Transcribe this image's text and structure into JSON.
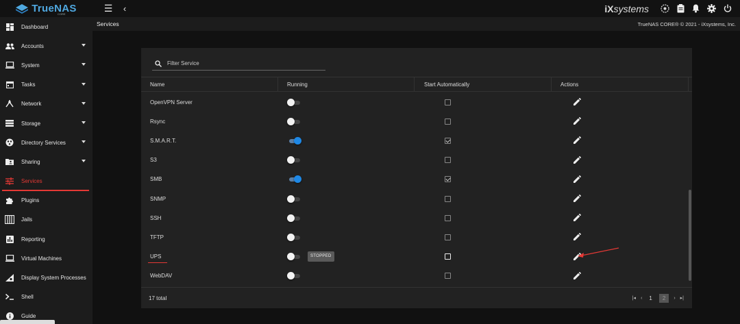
{
  "topbar": {
    "brand": "TrueNAS",
    "brand_sub": "CORE",
    "vendor_logo": "iXsystems",
    "icons": [
      "menu-icon",
      "chevron-left-icon",
      "truecommand-icon",
      "clipboard-icon",
      "bell-icon",
      "gear-icon",
      "power-icon"
    ]
  },
  "page": {
    "title": "Services",
    "copyright": "TrueNAS CORE® © 2021 - iXsystems, Inc."
  },
  "sidebar": {
    "items": [
      {
        "label": "Dashboard",
        "icon": "dashboard-icon",
        "expandable": false
      },
      {
        "label": "Accounts",
        "icon": "people-icon",
        "expandable": true
      },
      {
        "label": "System",
        "icon": "laptop-icon",
        "expandable": true
      },
      {
        "label": "Tasks",
        "icon": "calendar-icon",
        "expandable": true
      },
      {
        "label": "Network",
        "icon": "network-icon",
        "expandable": true
      },
      {
        "label": "Storage",
        "icon": "storage-icon",
        "expandable": true
      },
      {
        "label": "Directory Services",
        "icon": "directory-icon",
        "expandable": true
      },
      {
        "label": "Sharing",
        "icon": "folder-shared-icon",
        "expandable": true
      },
      {
        "label": "Services",
        "icon": "tune-icon",
        "expandable": false,
        "active": true
      },
      {
        "label": "Plugins",
        "icon": "puzzle-icon",
        "expandable": false
      },
      {
        "label": "Jails",
        "icon": "jail-icon",
        "expandable": false
      },
      {
        "label": "Reporting",
        "icon": "chart-icon",
        "expandable": false
      },
      {
        "label": "Virtual Machines",
        "icon": "computer-icon",
        "expandable": false
      },
      {
        "label": "Display System Processes",
        "icon": "cpu-icon",
        "expandable": false
      },
      {
        "label": "Shell",
        "icon": "terminal-icon",
        "expandable": false
      },
      {
        "label": "Guide",
        "icon": "info-icon",
        "expandable": false
      }
    ]
  },
  "filter": {
    "placeholder": "Filter Service"
  },
  "table": {
    "columns": [
      "Name",
      "Running",
      "Start Automatically",
      "Actions"
    ],
    "rows": [
      {
        "name": "OpenVPN Server",
        "running": false,
        "start_auto": false
      },
      {
        "name": "Rsync",
        "running": false,
        "start_auto": false
      },
      {
        "name": "S.M.A.R.T.",
        "running": true,
        "start_auto": true
      },
      {
        "name": "S3",
        "running": false,
        "start_auto": false
      },
      {
        "name": "SMB",
        "running": true,
        "start_auto": true
      },
      {
        "name": "SNMP",
        "running": false,
        "start_auto": false
      },
      {
        "name": "SSH",
        "running": false,
        "start_auto": false
      },
      {
        "name": "TFTP",
        "running": false,
        "start_auto": false
      },
      {
        "name": "UPS",
        "running": false,
        "start_auto": false,
        "tooltip": "STOPPED",
        "highlight": true
      },
      {
        "name": "WebDAV",
        "running": false,
        "start_auto": false
      }
    ]
  },
  "footer": {
    "total": "17 total",
    "pages": [
      "1",
      "2"
    ],
    "current_page": "2"
  },
  "colors": {
    "accent_red": "#e53935",
    "toggle_on": "#1e88e5",
    "brand_blue": "#4fa8e0"
  }
}
